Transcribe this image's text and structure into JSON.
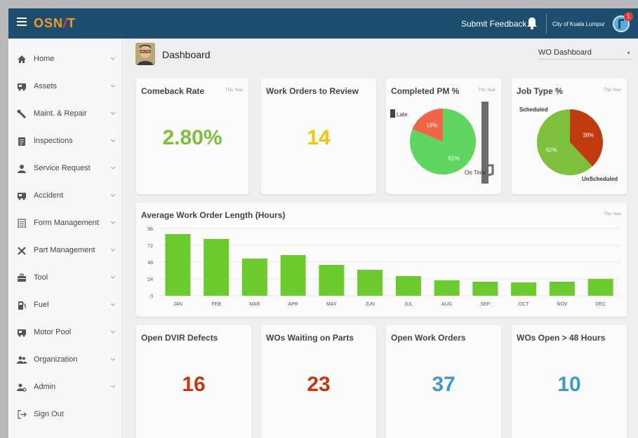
{
  "header": {
    "logo": {
      "part1": "OSN",
      "part2": "/",
      "part3": "T"
    },
    "feedback_label": "Submit Feedback",
    "city": "City of Kuala Lumpur",
    "notification_count": "1",
    "bar_color": "#1d4e6e"
  },
  "sidebar": {
    "items": [
      {
        "label": "Home",
        "icon": "home-icon"
      },
      {
        "label": "Assets",
        "icon": "truck-icon"
      },
      {
        "label": "Maint. & Repair",
        "icon": "wrench-icon"
      },
      {
        "label": "Inspections",
        "icon": "clipboard-icon"
      },
      {
        "label": "Service Request",
        "icon": "person-icon"
      },
      {
        "label": "Accident",
        "icon": "truck-icon"
      },
      {
        "label": "Form Management",
        "icon": "form-icon"
      },
      {
        "label": "Part Management",
        "icon": "tools-icon"
      },
      {
        "label": "Tool",
        "icon": "toolbox-icon"
      },
      {
        "label": "Fuel",
        "icon": "fuel-icon"
      },
      {
        "label": "Motor Pool",
        "icon": "truck-icon"
      },
      {
        "label": "Organization",
        "icon": "group-icon"
      },
      {
        "label": "Admin",
        "icon": "admin-icon"
      },
      {
        "label": "Sign Out",
        "icon": "sign-out-icon"
      }
    ]
  },
  "page": {
    "title": "Dashboard",
    "wo_select": "WO Dashboard"
  },
  "cards": {
    "comeback": {
      "title": "Comeback Rate",
      "note": "This Year",
      "value": "2.80%",
      "color": "#7dbf3a"
    },
    "review": {
      "title": "Work Orders to Review",
      "value": "14",
      "color": "#f2c40f"
    },
    "pm": {
      "title": "Completed PM %",
      "note": "This Year",
      "late_label": "Late",
      "ontime_label": "On Time",
      "late_pct": "19%",
      "ontime_pct": "81%"
    },
    "jobtype": {
      "title": "Job Type %",
      "note": "This Year",
      "scheduled_label": "Scheduled",
      "unscheduled_label": "UnScheduled",
      "scheduled_pct": "62%",
      "unscheduled_pct": "38%"
    },
    "avg": {
      "title": "Average Work Order Length (Hours)",
      "note": "This Year"
    },
    "dvir": {
      "title": "Open DVIR Defects",
      "value": "16",
      "color": "#c0390f"
    },
    "parts": {
      "title": "WOs Waiting on Parts",
      "value": "23",
      "color": "#c0390f"
    },
    "open": {
      "title": "Open Work Orders",
      "value": "37",
      "color": "#3f9bc0"
    },
    "over48": {
      "title": "WOs Open > 48 Hours",
      "value": "10",
      "color": "#3f9bc0"
    }
  },
  "chart_data": [
    {
      "type": "pie",
      "slices": [
        {
          "label": "Late",
          "value": 19,
          "color": "#f06449"
        },
        {
          "label": "On Time",
          "value": 81,
          "color": "#5fd65f"
        }
      ]
    },
    {
      "type": "pie",
      "slices": [
        {
          "label": "Scheduled",
          "value": 62,
          "color": "#7dc03c"
        },
        {
          "label": "UnScheduled",
          "value": 38,
          "color": "#c0390f"
        }
      ]
    },
    {
      "type": "bar",
      "title": "Average Work Order Length (Hours)",
      "categories": [
        "JAN",
        "FEB",
        "MAR",
        "APR",
        "MAY",
        "JUN",
        "JUL",
        "AUG",
        "SEP",
        "OCT",
        "NOV",
        "DEC"
      ],
      "values": [
        88,
        81,
        53,
        58,
        44,
        37,
        28,
        22,
        20,
        19,
        20,
        24
      ],
      "yticks": [
        0,
        24,
        48,
        72,
        96
      ],
      "ylim": [
        0,
        96
      ],
      "color": "#6cc92e",
      "grid": true
    }
  ]
}
